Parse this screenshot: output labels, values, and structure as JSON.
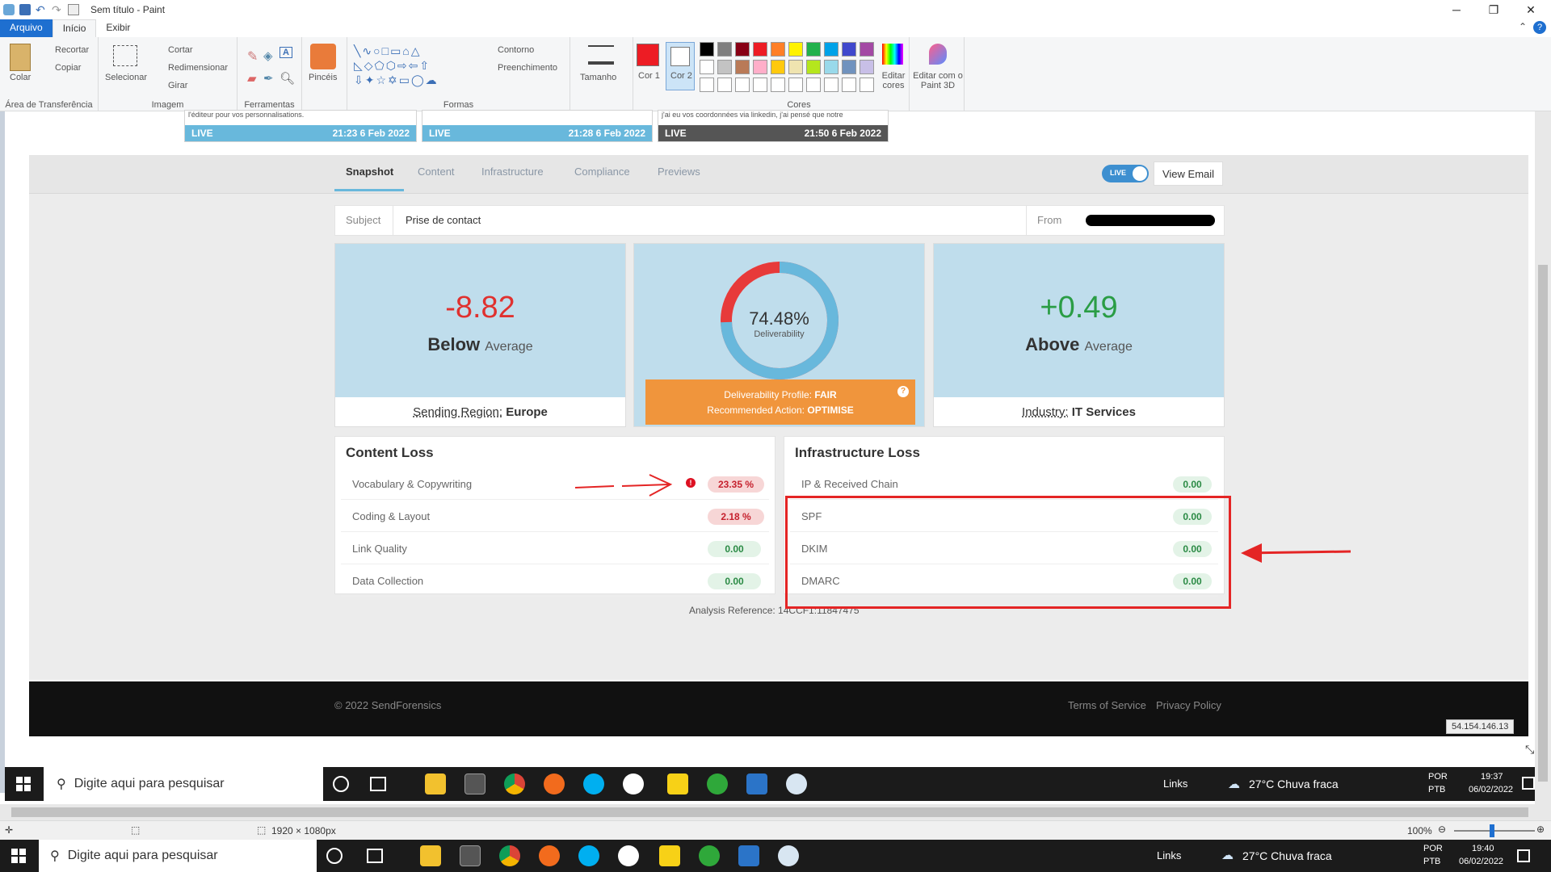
{
  "paint": {
    "window_title": "Sem título - Paint",
    "tabs": [
      "Arquivo",
      "Início",
      "Exibir"
    ],
    "clipboard": {
      "paste": "Colar",
      "cut": "Recortar",
      "copy": "Copiar",
      "group": "Área de Transferência"
    },
    "image": {
      "select": "Selecionar",
      "crop": "Cortar",
      "resize": "Redimensionar",
      "rotate": "Girar",
      "group": "Imagem"
    },
    "tools_group": "Ferramentas",
    "brushes": "Pincéis",
    "shapes": {
      "outline": "Contorno",
      "fill": "Preenchimento",
      "group": "Formas"
    },
    "size": "Tamanho",
    "color1": "Cor 1",
    "color2": "Cor 2",
    "colors_group": "Cores",
    "edit_colors": "Editar cores",
    "edit_paint3d": "Editar com o Paint 3D",
    "palette": [
      "#000000",
      "#7f7f7f",
      "#880015",
      "#ed1c24",
      "#ff7f27",
      "#fff200",
      "#22b14c",
      "#00a2e8",
      "#3f48cc",
      "#a349a4",
      "#ffffff",
      "#c3c3c3",
      "#b97a57",
      "#ffaec9",
      "#ffc90e",
      "#efe4b0",
      "#b5e61d",
      "#99d9ea",
      "#7092be",
      "#c8bfe7"
    ],
    "status": {
      "size": "1920 × 1080px",
      "zoom": "100%"
    }
  },
  "site": {
    "live_cards": [
      {
        "snippet": "l'éditeur pour vos personnalisations.",
        "status": "LIVE",
        "time": "21:23 6 Feb 2022"
      },
      {
        "snippet": "",
        "status": "LIVE",
        "time": "21:28 6 Feb 2022"
      },
      {
        "snippet": "j'ai eu vos coordonnées via linkedin, j'ai pensé que notre",
        "status": "LIVE",
        "time": "21:50 6 Feb 2022"
      }
    ],
    "tabs": [
      "Snapshot",
      "Content",
      "Infrastructure",
      "Compliance",
      "Previews"
    ],
    "live_toggle": "LIVE",
    "view_email": "View Email",
    "subject_label": "Subject",
    "subject_value": "Prise de contact",
    "from_label": "From",
    "region": {
      "value": "-8.82",
      "word": "Below",
      "suffix": "Average",
      "label": "Sending Region:",
      "name": "Europe"
    },
    "deliverability": {
      "percent": "74.48%",
      "percent_value": 74.48,
      "label": "Deliverability",
      "profile_label": "Deliverability Profile:",
      "profile": "FAIR",
      "action_label": "Recommended Action:",
      "action": "OPTIMISE"
    },
    "industry": {
      "value": "+0.49",
      "word": "Above",
      "suffix": "Average",
      "label": "Industry:",
      "name": "IT Services"
    },
    "content_loss": {
      "title": "Content Loss",
      "rows": [
        {
          "name": "Vocabulary & Copywriting",
          "value": "23.35 %",
          "status": "red"
        },
        {
          "name": "Coding & Layout",
          "value": "2.18 %",
          "status": "red"
        },
        {
          "name": "Link Quality",
          "value": "0.00",
          "status": "green"
        },
        {
          "name": "Data Collection",
          "value": "0.00",
          "status": "green"
        }
      ]
    },
    "infra_loss": {
      "title": "Infrastructure Loss",
      "rows": [
        {
          "name": "IP & Received Chain",
          "value": "0.00"
        },
        {
          "name": "SPF",
          "value": "0.00"
        },
        {
          "name": "DKIM",
          "value": "0.00"
        },
        {
          "name": "DMARC",
          "value": "0.00"
        }
      ]
    },
    "analysis_ref": "Analysis Reference: 14CCF1:11847475",
    "copyright": "© 2022 SendForensics",
    "terms": "Terms of Service",
    "privacy": "Privacy Policy",
    "ip": "54.154.146.13"
  },
  "taskbar": {
    "search_placeholder": "Digite aqui para pesquisar",
    "links": "Links",
    "weather": "27°C  Chuva fraca",
    "lang": "POR",
    "kbd": "PTB",
    "time_inner": "19:37",
    "date_inner": "06/02/2022",
    "time_outer": "19:40",
    "date_outer": "06/02/2022"
  }
}
